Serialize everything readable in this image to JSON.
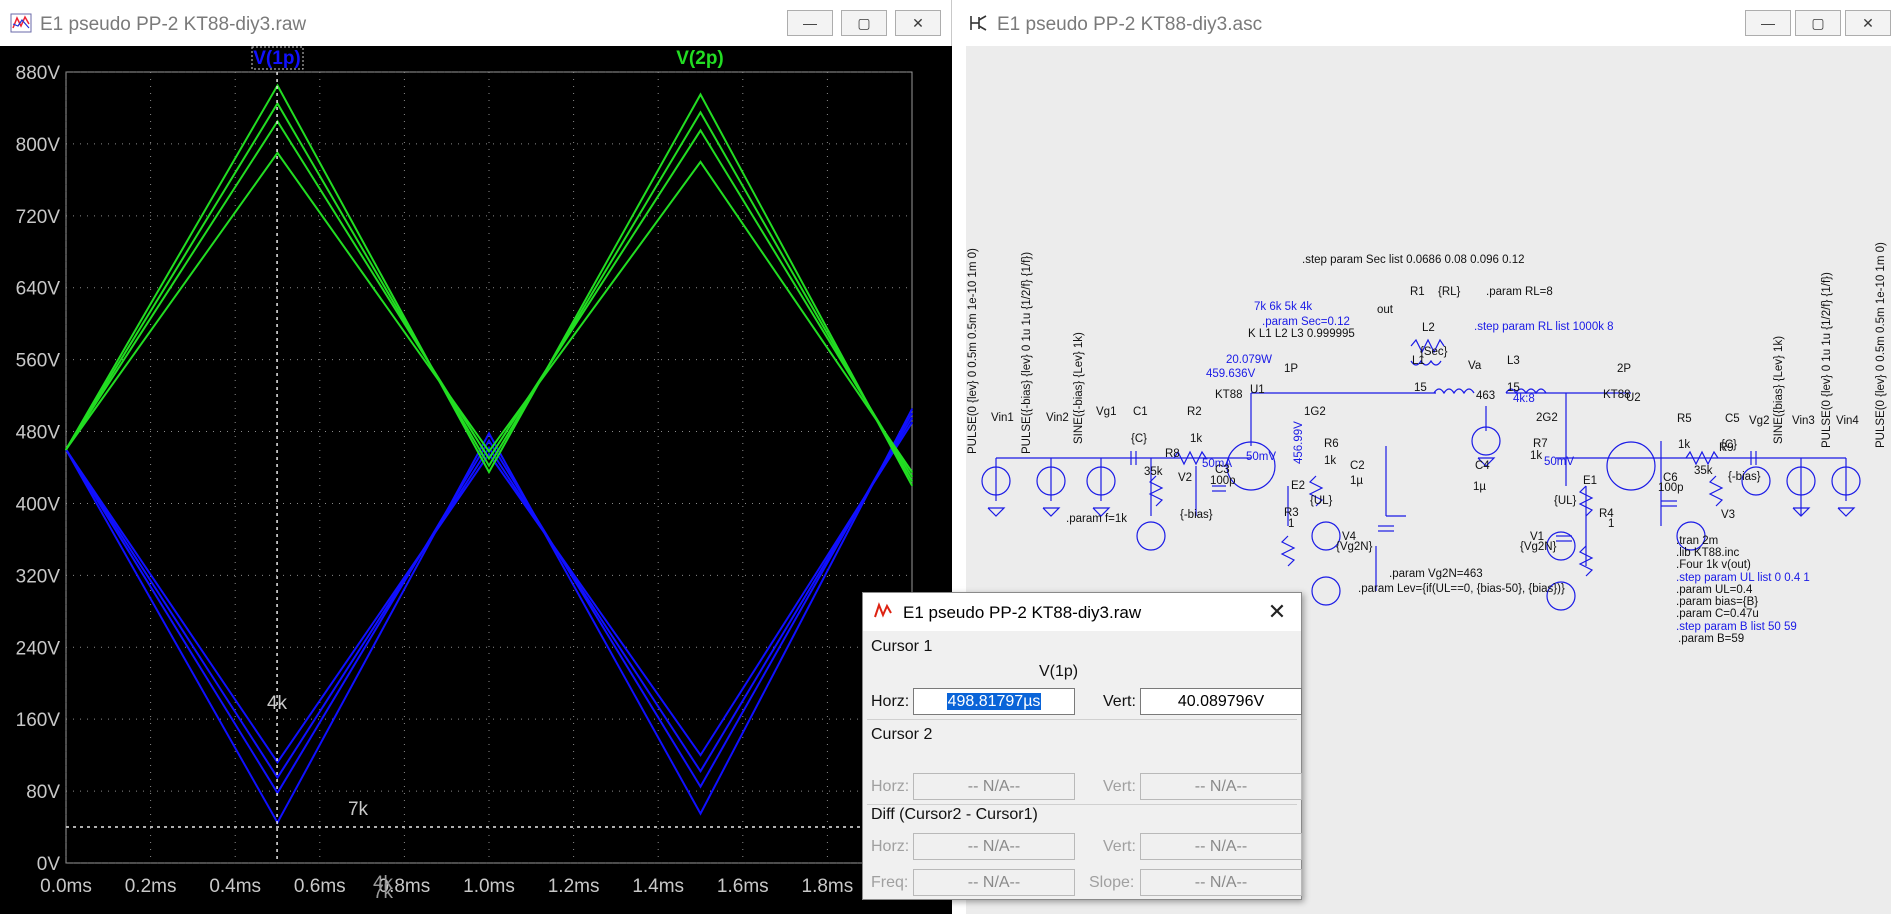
{
  "waveform_window": {
    "title": "E1 pseudo PP-2 KT88-diy3.raw",
    "trace_labels": [
      "V(1p)",
      "V(2p)"
    ],
    "trace_colors": [
      "#1010ff",
      "#22dd22"
    ],
    "plot_annotations": [
      "4k",
      "7k",
      "4k",
      "7k"
    ]
  },
  "schematic_window": {
    "title": "E1 pseudo PP-2 KT88-diy3.asc",
    "wire_color": "#1a1ae6",
    "texts": {
      "vin1_src": "PULSE(0 {lev} 0 0.5m 0.5m 1e-10 1m 0)",
      "vin2_src": "PULSE({-bias} {lev} 0 1u 1u {1/2/f} {1/f})",
      "vg1_src": "SINE({-bias} {Lev} 1k)",
      "vg2_src": "SINE({bias} {Lev} 1k)",
      "vin3_src": "PULSE(0 {lev} 0 1u 1u {1/2/f} {1/f})",
      "vin4_src": "PULSE(0 {lev} 0 0.5m 0.5m 1e-10 1m 0)",
      "step_sec": ".step param Sec list 0.0686 0.08 0.096 0.12",
      "r1": "R1",
      "rl": "{RL}",
      "param_rl": ".param RL=8",
      "out": "out",
      "l2": "L2",
      "step_rl": ".step param RL list 1000k 8",
      "sec": "{Sec}",
      "imp_list": "7k 6k 5k 4k",
      "param_sec": ".param Sec=0.12",
      "k_line": "K L1 L2 L3 0.999995",
      "power": "20.079W",
      "v1p": "459.636V",
      "n1p": "1P",
      "l1": "L1",
      "n15a": "15",
      "va": "Va",
      "l3": "L3",
      "n15b": "15",
      "n463": "463",
      "ratio": "4k:8",
      "n2p": "2P",
      "kt88a": "KT88",
      "u1": "U1",
      "kt88b": "KT88",
      "u2": "U2",
      "vin1": "Vin1",
      "vin2": "Vin2",
      "vg1": "Vg1",
      "c1": "C1",
      "c1v": "{C}",
      "r2": "R2",
      "r2v": "1k",
      "r8": "R8",
      "r8v": "35k",
      "ma50": "50mA",
      "c3": "C3",
      "c3v": "100p",
      "v2": "V2",
      "mbias1": "{-bias}",
      "mv50a": "50mV",
      "g2v": "456.99V",
      "n1g2": "1G2",
      "r6": "R6",
      "r6v": "1k",
      "c2": "C2",
      "c2v": "1µ",
      "e2": "E2",
      "ul1": "{UL}",
      "r3": "R3",
      "r3v": "1",
      "v4": "V4",
      "vg2n1": "{Vg2N}",
      "n2g2": "2G2",
      "r7": "R7",
      "r7v": "1k",
      "c4": "C4",
      "c4v": "1µ",
      "e1": "E1",
      "ul2": "{UL}",
      "mv50b": "50mV",
      "r4": "R4",
      "r4v": "1",
      "v1": "V1",
      "vg2n2": "{Vg2N}",
      "c6": "C6",
      "c6v": "100p",
      "r5": "R5",
      "r5v": "1k",
      "c5": "C5",
      "c5v": "{C}",
      "r9": "R9",
      "r9v": "35k",
      "pbias": "{-bias}",
      "v3": "V3",
      "vg2": "Vg2",
      "vin3": "Vin3",
      "vin4": "Vin4",
      "param_f": ".param f=1k",
      "param_vg2n": ".param Vg2N=463",
      "param_lev": ".param Lev={if(UL==0, {bias-50}, {bias})}",
      "tran": ".tran 2m",
      "lib": ".lib KT88.inc",
      "four": ".Four 1k v(out)",
      "step_ul": ".step param UL list 0 0.4 1",
      "param_ul": ".param UL=0.4",
      "param_bias": ".param bias={B}",
      "param_c": ".param C=0.47u",
      "step_b": ".step param B list 50 59",
      "param_b": ".param B=59"
    }
  },
  "cursor_dialog": {
    "title": "E1 pseudo PP-2 KT88-diy3.raw",
    "close_glyph": "✕",
    "cursor1_label": "Cursor 1",
    "cursor1_trace": "V(1p)",
    "horz_label": "Horz:",
    "vert_label": "Vert:",
    "cursor1_horz": "498.81797µs",
    "cursor1_vert": "40.089796V",
    "cursor2_label": "Cursor 2",
    "cursor2_horz": "-- N/A--",
    "cursor2_vert": "-- N/A--",
    "diff_label": "Diff (Cursor2 - Cursor1)",
    "diff_horz": "-- N/A--",
    "diff_vert": "-- N/A--",
    "freq_label": "Freq:",
    "slope_label": "Slope:",
    "diff_freq": "-- N/A--",
    "diff_slope": "-- N/A--"
  },
  "chart_data": {
    "type": "line",
    "title": "",
    "xlabel": "",
    "ylabel": "",
    "xlim": [
      0.0,
      2.0
    ],
    "ylim": [
      0,
      880
    ],
    "x_unit": "ms",
    "y_unit": "V",
    "x_ticks": [
      "0.0ms",
      "0.2ms",
      "0.4ms",
      "0.6ms",
      "0.8ms",
      "1.0ms",
      "1.2ms",
      "1.4ms",
      "1.6ms",
      "1.8ms"
    ],
    "y_ticks": [
      "0V",
      "80V",
      "160V",
      "240V",
      "320V",
      "400V",
      "480V",
      "560V",
      "640V",
      "720V",
      "800V",
      "880V"
    ],
    "grid": true,
    "cursor_x_ms": 0.499,
    "cursor_y_v": 40.09,
    "series": [
      {
        "name": "V(1p)",
        "color": "#1010ff",
        "x": [
          0,
          0.5,
          1.0,
          1.5,
          2.0
        ],
        "values": [
          460,
          45,
          478,
          55,
          505
        ]
      },
      {
        "name": "V(1p)",
        "color": "#1010ff",
        "x": [
          0,
          0.5,
          1.0,
          1.5,
          2.0
        ],
        "values": [
          460,
          78,
          470,
          85,
          500
        ]
      },
      {
        "name": "V(1p)",
        "color": "#1010ff",
        "x": [
          0,
          0.5,
          1.0,
          1.5,
          2.0
        ],
        "values": [
          460,
          95,
          462,
          102,
          495
        ]
      },
      {
        "name": "V(1p)",
        "color": "#1010ff",
        "x": [
          0,
          0.5,
          1.0,
          1.5,
          2.0
        ],
        "values": [
          460,
          112,
          455,
          120,
          490
        ]
      },
      {
        "name": "V(2p)",
        "color": "#22dd22",
        "x": [
          0,
          0.5,
          1.0,
          1.5,
          2.0
        ],
        "values": [
          460,
          865,
          435,
          855,
          420
        ]
      },
      {
        "name": "V(2p)",
        "color": "#22dd22",
        "x": [
          0,
          0.5,
          1.0,
          1.5,
          2.0
        ],
        "values": [
          460,
          845,
          442,
          835,
          425
        ]
      },
      {
        "name": "V(2p)",
        "color": "#22dd22",
        "x": [
          0,
          0.5,
          1.0,
          1.5,
          2.0
        ],
        "values": [
          460,
          825,
          450,
          815,
          430
        ]
      },
      {
        "name": "V(2p)",
        "color": "#22dd22",
        "x": [
          0,
          0.5,
          1.0,
          1.5,
          2.0
        ],
        "values": [
          460,
          790,
          458,
          780,
          435
        ]
      }
    ]
  }
}
